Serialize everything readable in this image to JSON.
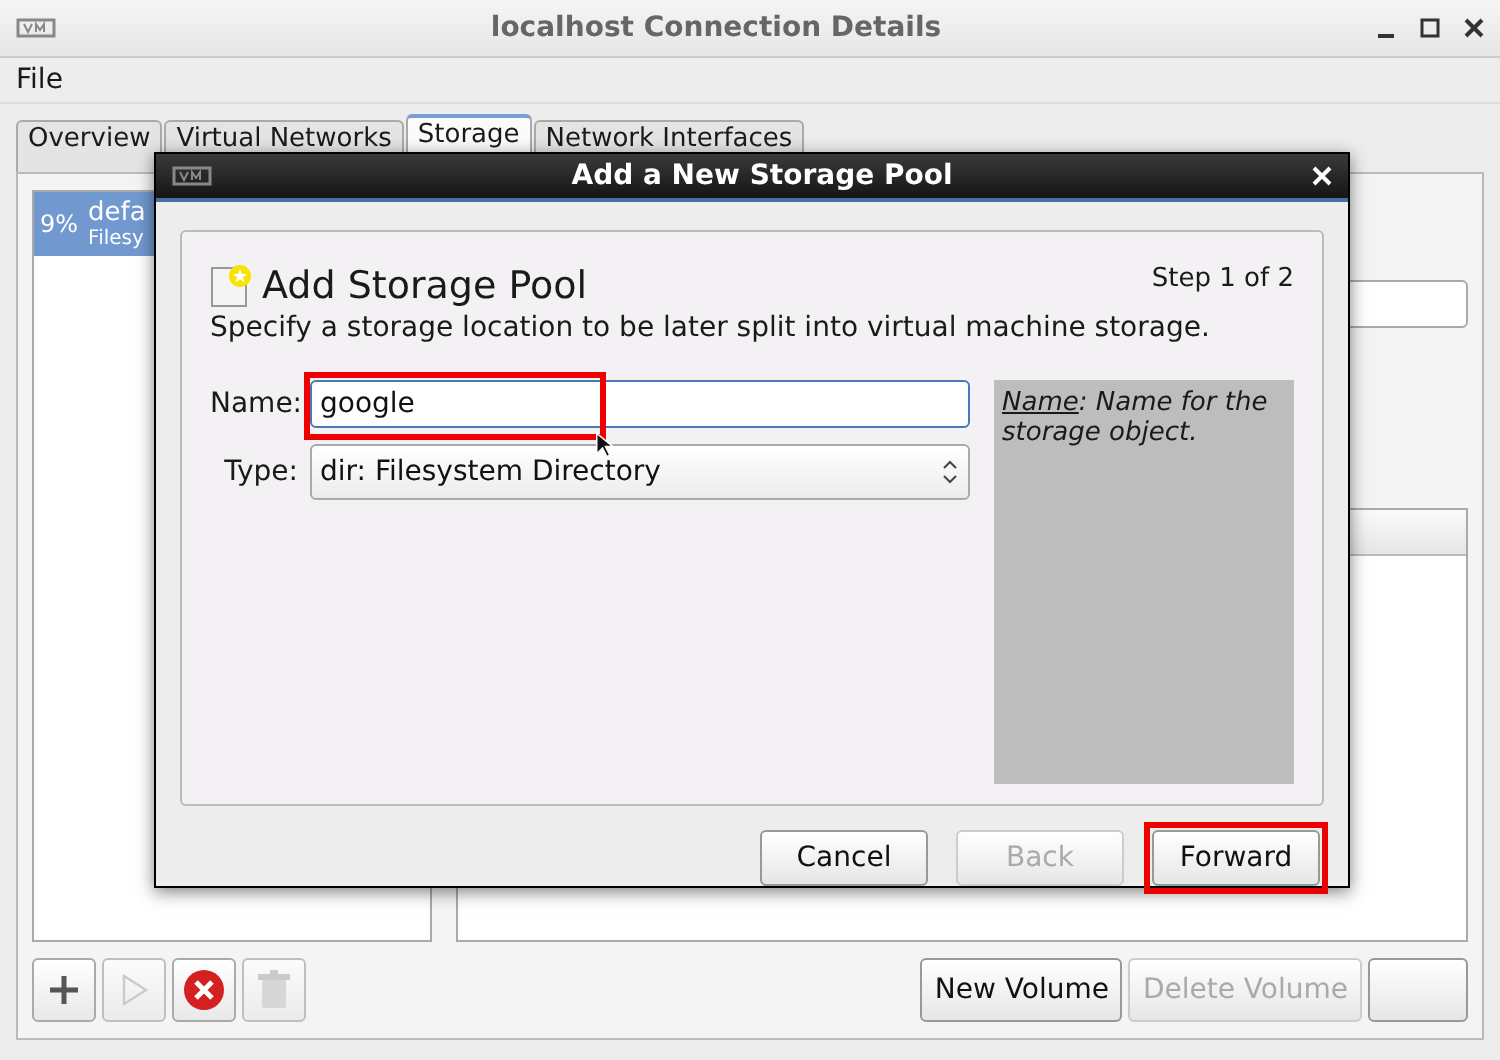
{
  "window": {
    "title": "localhost Connection Details"
  },
  "menu": [
    "File"
  ],
  "tabs": [
    {
      "label": "Overview",
      "selected": false
    },
    {
      "label": "Virtual Networks",
      "selected": false
    },
    {
      "label": "Storage",
      "selected": true
    },
    {
      "label": "Network Interfaces",
      "selected": false
    }
  ],
  "pools": [
    {
      "usage": "9%",
      "name": "defa",
      "type": "Filesy",
      "selected": true
    }
  ],
  "toolbar": [
    {
      "kind": "add",
      "disabled": false
    },
    {
      "kind": "start",
      "disabled": true
    },
    {
      "kind": "stop",
      "disabled": false
    },
    {
      "kind": "delete",
      "disabled": true
    }
  ],
  "volume_buttons": [
    {
      "label": "New Volume",
      "disabled": false
    },
    {
      "label": "Delete Volume",
      "disabled": true
    },
    {
      "disabled": false
    }
  ],
  "dialog": {
    "title": "Add a New Storage Pool",
    "heading": "Add Storage Pool",
    "step": "Step 1 of 2",
    "description": "Specify a storage location to be later split into virtual machine storage.",
    "fields": [
      {
        "kind": "text",
        "label": "Name:",
        "value": "google",
        "highlighted": true
      },
      {
        "kind": "combo",
        "label": "Type:",
        "value": "dir: Filesystem Directory"
      }
    ],
    "hint": {
      "term": "Name",
      "text": ": Name for the storage object."
    },
    "buttons": [
      {
        "label": "Cancel",
        "disabled": false,
        "highlighted": false
      },
      {
        "label": "Back",
        "disabled": true,
        "highlighted": false
      },
      {
        "label": "Forward",
        "disabled": false,
        "highlighted": true
      }
    ]
  }
}
